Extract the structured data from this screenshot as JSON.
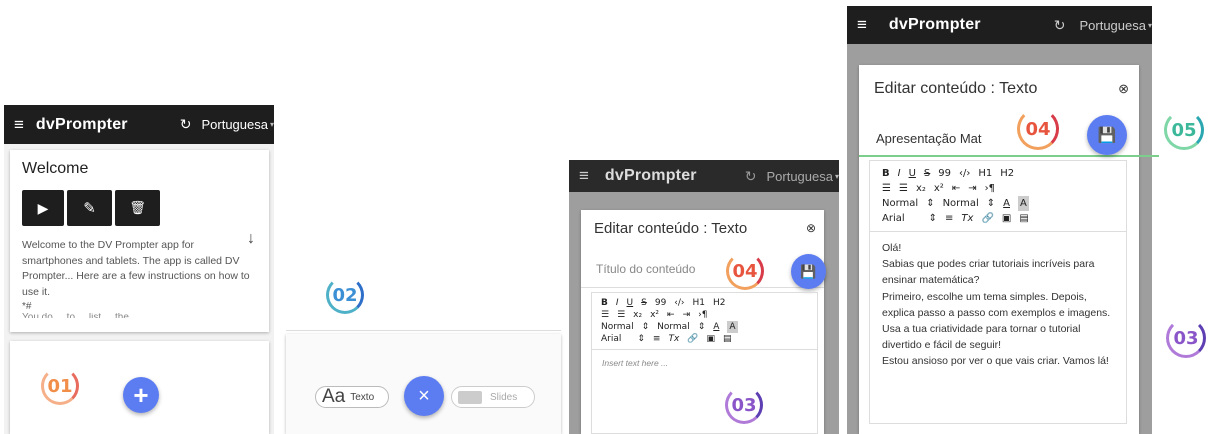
{
  "app": {
    "menu_icon": "≡",
    "title": "dvPrompter",
    "refresh_icon": "↻",
    "language": "Portuguesa",
    "caret": "▾"
  },
  "screen1": {
    "welcome_title": "Welcome",
    "play_icon": "▶",
    "edit_icon": "✎",
    "delete_icon": "🗑",
    "expand_icon": "↓",
    "welcome_text": "Welcome to the DV Prompter app for smartphones and tablets. The app is called DV Prompter... Here are a few instructions on how to use it.",
    "markdown_hint": "*#",
    "truncated_line": "You do ... to ... list ... the ... ",
    "badge": "01",
    "add_icon": "+"
  },
  "screen2": {
    "badge": "02",
    "texto_glyph": "Aa",
    "texto_label": "Texto",
    "close_icon": "×",
    "slides_label": "Slides"
  },
  "screen3": {
    "dialog_title": "Editar conteúdo : Texto",
    "close_icon": "⊗",
    "title_placeholder": "Título do conteúdo",
    "badge_save": "04",
    "save_icon": "💾",
    "toolbar_row1": [
      "B",
      "I",
      "U",
      "S",
      "99",
      "‹/›",
      "H1",
      "H2"
    ],
    "toolbar_row2": [
      "☰",
      "☰",
      "x₂",
      "x²",
      "⇤",
      "⇥",
      "›¶"
    ],
    "toolbar_row3": [
      "Normal",
      "⇕",
      "Normal",
      "⇕",
      "A",
      "A"
    ],
    "toolbar_row4": [
      "Arial",
      "⇕",
      "≡",
      "Tx",
      "🔗",
      "▣",
      "▤"
    ],
    "editor_placeholder": "Insert text here ...",
    "badge_editor": "03"
  },
  "screen4": {
    "dialog_title": "Editar conteúdo : Texto",
    "close_icon": "⊗",
    "title_value": "Apresentação Mat",
    "badge_save": "04",
    "save_icon": "💾",
    "badge_outside": "05",
    "toolbar_row1": [
      "B",
      "I",
      "U",
      "S",
      "99",
      "‹/›",
      "H1",
      "H2"
    ],
    "toolbar_row2": [
      "☰",
      "☰",
      "x₂",
      "x²",
      "⇤",
      "⇥",
      "›¶"
    ],
    "toolbar_row3": [
      "Normal",
      "⇕",
      "Normal",
      "⇕",
      "A",
      "A"
    ],
    "toolbar_row4": [
      "Arial",
      "⇕",
      "≡",
      "Tx",
      "🔗",
      "▣",
      "▤"
    ],
    "content": [
      "Olá!",
      "Sabias que podes criar tutoriais incríveis para ensinar matemática?",
      "Primeiro, escolhe um tema simples. Depois, explica passo a passo com exemplos e imagens.",
      "Usa a tua criatividade para tornar o tutorial divertido e fácil de seguir!",
      "Estou ansioso por ver o que vais criar. Vamos lá!"
    ],
    "badge_right": "03"
  }
}
